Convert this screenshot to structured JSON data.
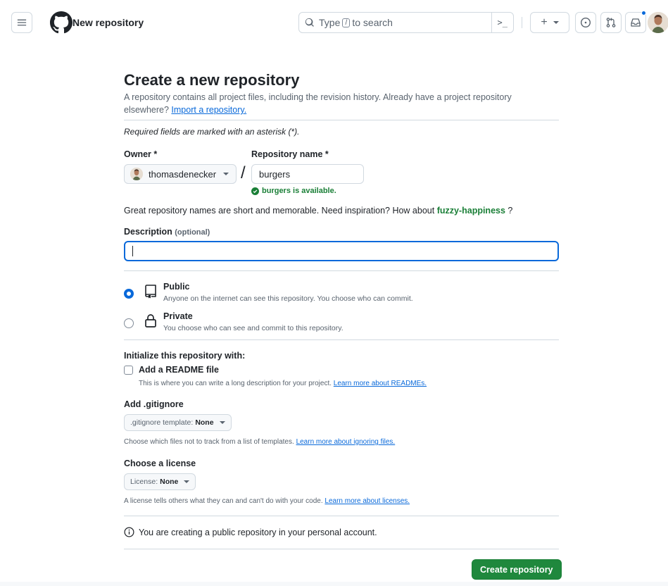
{
  "header": {
    "title": "New repository",
    "search": {
      "prefix": "Type",
      "key": "/",
      "suffix": "to search"
    },
    "terminal_symbol": ">_",
    "plus_symbol": "+"
  },
  "page": {
    "title": "Create a new repository",
    "intro": "A repository contains all project files, including the revision history. Already have a project repository elsewhere?",
    "import_link": "Import a repository.",
    "required_note": "Required fields are marked with an asterisk (*)."
  },
  "form": {
    "owner_label": "Owner *",
    "owner_value": "thomasdenecker",
    "separator": "/",
    "repo_label": "Repository name *",
    "repo_value": "burgers",
    "availability": "burgers is available.",
    "hint_prefix": "Great repository names are short and memorable. Need inspiration? How about",
    "suggestion": "fuzzy-happiness",
    "hint_suffix": "?",
    "description_label": "Description",
    "description_optional": "(optional)",
    "description_value": ""
  },
  "visibility": {
    "public": {
      "title": "Public",
      "desc": "Anyone on the internet can see this repository. You choose who can commit.",
      "selected": true
    },
    "private": {
      "title": "Private",
      "desc": "You choose who can see and commit to this repository.",
      "selected": false
    }
  },
  "initialize": {
    "title": "Initialize this repository with:",
    "readme_label": "Add a README file",
    "readme_checked": false,
    "readme_desc": "This is where you can write a long description for your project.",
    "readme_link": "Learn more about READMEs."
  },
  "gitignore": {
    "title": "Add .gitignore",
    "select_label": ".gitignore template:",
    "select_value": "None",
    "desc": "Choose which files not to track from a list of templates.",
    "link": "Learn more about ignoring files."
  },
  "license": {
    "title": "Choose a license",
    "select_label": "License:",
    "select_value": "None",
    "desc": "A license tells others what they can and can't do with your code.",
    "link": "Learn more about licenses."
  },
  "notice": "You are creating a public repository in your personal account.",
  "submit_label": "Create repository",
  "colors": {
    "accent": "#0969da",
    "success": "#1a7f37",
    "primary_button": "#1f883d"
  }
}
